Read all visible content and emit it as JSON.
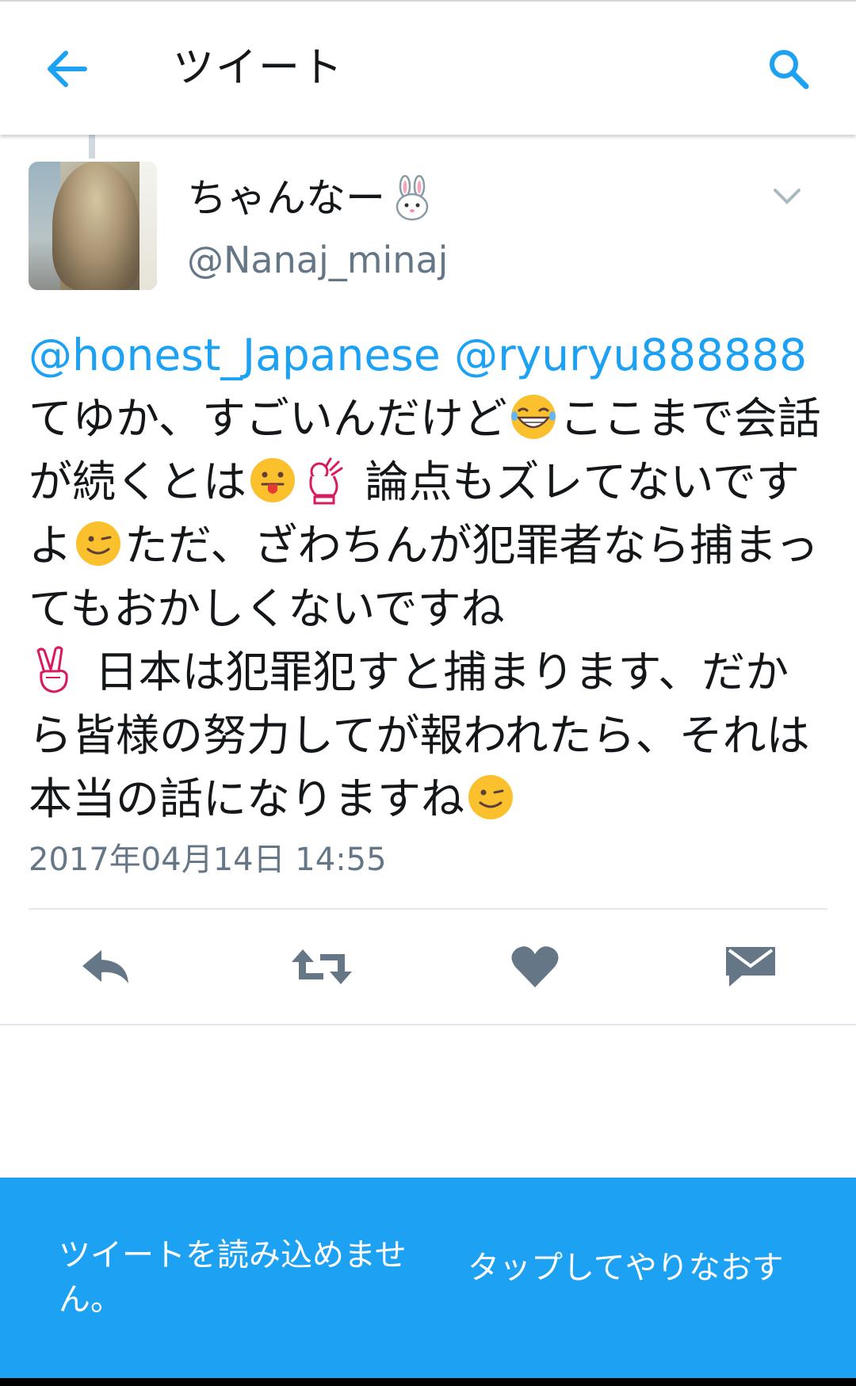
{
  "header": {
    "title": "ツイート",
    "back_icon": "arrow-left-icon",
    "search_icon": "search-icon"
  },
  "tweet": {
    "display_name": "ちゃんなー",
    "name_emoji": "rabbit-face-emoji",
    "handle": "@Nanaj_minaj",
    "mention_1": "@honest_Japanese",
    "mention_2": "@ryuryu888888",
    "text_1": "てゆか、すごいんだけど",
    "text_2": "ここまで会話が続くとは",
    "text_3": " 論点もズレてないですよ",
    "text_4": "ただ、ざわちんが犯罪者なら捕まってもおかしくないですね",
    "text_5": " 日本は犯罪犯すと捕まります、だから皆様の努力してが報われたら、それは本当の話になりますね",
    "timestamp": "2017年04月14日 14:55",
    "emojis": [
      "laughing-face-emoji",
      "tongue-face-emoji",
      "ok-hand-emoji",
      "winking-face-emoji",
      "victory-hand-emoji",
      "winking-face-emoji"
    ]
  },
  "actions": {
    "reply_icon": "reply-icon",
    "retweet_icon": "retweet-icon",
    "like_icon": "heart-icon",
    "dm_icon": "direct-message-icon"
  },
  "error_bar": {
    "message": "ツイートを読み込めません。",
    "retry_label": "タップしてやりなおす"
  },
  "colors": {
    "accent": "#1da1f2",
    "text": "#14171a",
    "secondary": "#657786",
    "icon": "#657786",
    "divider": "#e1e8ed"
  }
}
